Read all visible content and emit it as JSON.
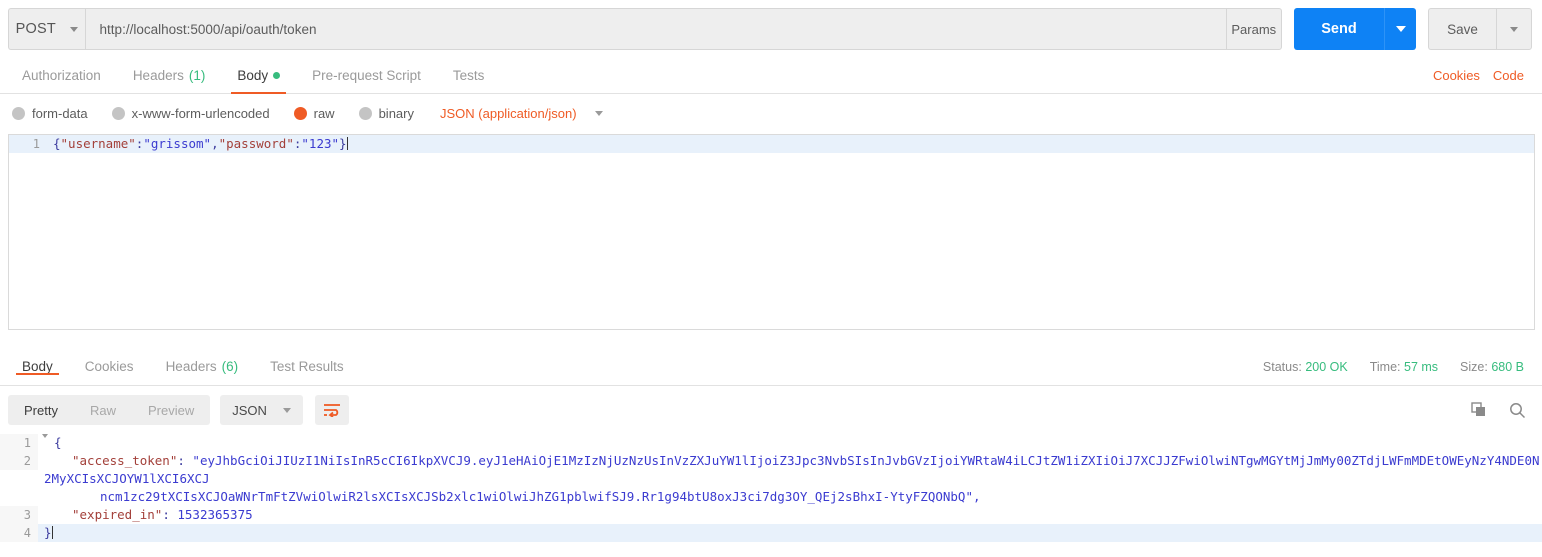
{
  "request": {
    "method": "POST",
    "url": "http://localhost:5000/api/oauth/token",
    "params_label": "Params",
    "send_label": "Send",
    "save_label": "Save",
    "tabs": [
      {
        "label": "Authorization",
        "count": "",
        "dot": false,
        "active": false
      },
      {
        "label": "Headers",
        "count": "(1)",
        "dot": false,
        "active": false
      },
      {
        "label": "Body",
        "count": "",
        "dot": true,
        "active": true
      },
      {
        "label": "Pre-request Script",
        "count": "",
        "dot": false,
        "active": false
      },
      {
        "label": "Tests",
        "count": "",
        "dot": false,
        "active": false
      }
    ],
    "tabs_right": [
      {
        "label": "Cookies"
      },
      {
        "label": "Code"
      }
    ],
    "body_types": [
      {
        "label": "form-data",
        "checked": false
      },
      {
        "label": "x-www-form-urlencoded",
        "checked": false
      },
      {
        "label": "raw",
        "checked": true
      },
      {
        "label": "binary",
        "checked": false
      }
    ],
    "content_type": "JSON (application/json)",
    "body_editor": {
      "line_number": "1",
      "json": {
        "open_brace": "{",
        "key_username": "\"username\"",
        "colon1": ":",
        "val_username": "\"grissom\"",
        "comma": ",",
        "key_password": "\"password\"",
        "colon2": ":",
        "val_password": "\"123\"",
        "close_brace": "}"
      }
    }
  },
  "response": {
    "tabs": [
      {
        "label": "Body",
        "count": "",
        "active": true
      },
      {
        "label": "Cookies",
        "count": "",
        "active": false
      },
      {
        "label": "Headers",
        "count": "(6)",
        "active": false
      },
      {
        "label": "Test Results",
        "count": "",
        "active": false
      }
    ],
    "stats": {
      "status_label": "Status:",
      "status_value": "200 OK",
      "time_label": "Time:",
      "time_value": "57 ms",
      "size_label": "Size:",
      "size_value": "680 B"
    },
    "view_modes": [
      {
        "label": "Pretty",
        "active": true
      },
      {
        "label": "Raw",
        "active": false
      },
      {
        "label": "Preview",
        "active": false
      }
    ],
    "format": "JSON",
    "icons": {
      "wrap": "word-wrap-icon",
      "copy": "copy-icon",
      "search": "search-icon"
    },
    "body_lines": [
      {
        "num": "1",
        "fold": true,
        "indent": 0,
        "content": "{"
      },
      {
        "num": "2",
        "fold": false,
        "indent": 1,
        "content": "\"access_token\": \"eyJhbGciOiJIUzI1NiIsInR5cCI6IkpXVCJ9.eyJ1eHAiOjE1MzIzNjUzNzUsInVzZXJuYW1lIjoiZ3Jpc3NvbSIsInJvbGVzIjoiYWRtaW4iLCJtZW1iZXIiOiJ7XCJJZFwiOlwiNTgwMGYtMjMyMy00ZTdjLWFmMDEtOWEyNzY4NDE0N2MyXCIsXCJOYW1lXCI6XCJncmlzc29tXCIsXCJOaWNrTmFtZVwiOlwiR2lsXCIsXCJSb2xlc1wiOlwiSmhZG1pblwifSJ9.Rr1g94btU8oxJ3ci7dg3OY_QEj2sBhxI-YtyFZQONbQ\","
      },
      {
        "num": "3",
        "fold": false,
        "indent": 1,
        "content": "\"expired_in\": 1532365375"
      },
      {
        "num": "4",
        "fold": false,
        "indent": 0,
        "content": "}"
      }
    ],
    "token": {
      "key": "\"access_token\"",
      "part1": "\"eyJhbGciOiJIUzI1NiIsInR5cCI6IkpXVCJ9.eyJ1eHAiOjE1MzIzNjUzNzUsInVzZXJuYW1lIjoiZ3Jpc3NvbSIsInJvbGVzIjoiYWRtaW4iLCJtZW1iZXIiOiJ7XCJJZFwiOlwiNTgwMGYtMjJmMy00ZTdjLWFmMDEtOWEyNzY4NDE0N2MyXCIsXCJOYW1lXCI6XCJ",
      "part2": "ncm1zc29tXCIsXCJOaWNrTmFtZVwiOlwiR2lsXCIsXCJSb2xlc1wiOlwiJhZG1pblwifSJ9.Rr1g94btU8oxJ3ci7dg3OY_QEj2sBhxI-YtyFZQONbQ\","
    },
    "expired": {
      "key": "\"expired_in\"",
      "colon": ": ",
      "value": "1532365375"
    }
  },
  "colors": {
    "accent_orange": "#ef5b25",
    "send_blue": "#0e82f5",
    "status_green": "#37bc7e",
    "toolbar_gray": "#eeeeee",
    "text_gray": "#5c5c5c"
  }
}
